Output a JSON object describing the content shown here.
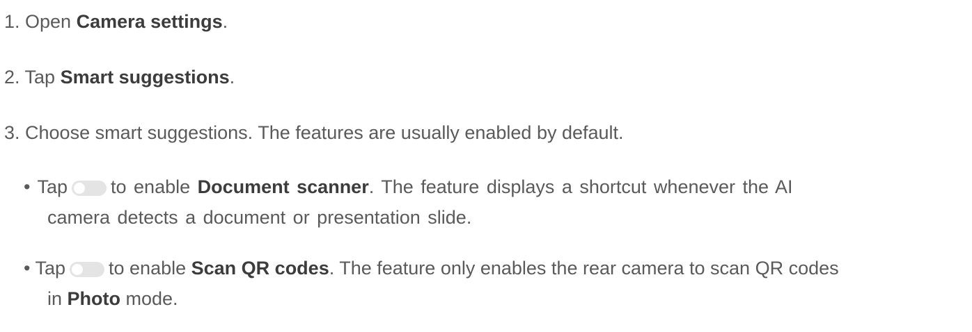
{
  "steps": [
    {
      "prefix": "1. Open ",
      "bold": "Camera settings",
      "suffix": "."
    },
    {
      "prefix": "2. Tap ",
      "bold": "Smart suggestions",
      "suffix": "."
    },
    {
      "prefix": "3. Choose smart suggestions. The features are usually enabled by default.",
      "bold": "",
      "suffix": ""
    }
  ],
  "bullets": [
    {
      "marker": "•",
      "lead": "Tap",
      "toggle_icon": "toggle-switch-off-icon",
      "mid": "to enable",
      "bold": "Document scanner",
      "rest_line1": ". The feature displays a shortcut whenever the AI",
      "line2": "camera detects a document or presentation slide."
    },
    {
      "marker": "•",
      "lead": "Tap",
      "toggle_icon": "toggle-switch-off-icon",
      "mid": "to enable",
      "bold": "Scan QR codes",
      "rest_line1": ". The feature only enables the rear camera to scan QR codes",
      "line2_prefix": "in ",
      "line2_bold": "Photo",
      "line2_suffix": " mode."
    }
  ],
  "colors": {
    "text": "#5a5a5a",
    "bold_text": "#3c3c3c",
    "toggle_track": "#e4e4e4",
    "toggle_knob": "#ffffff"
  }
}
